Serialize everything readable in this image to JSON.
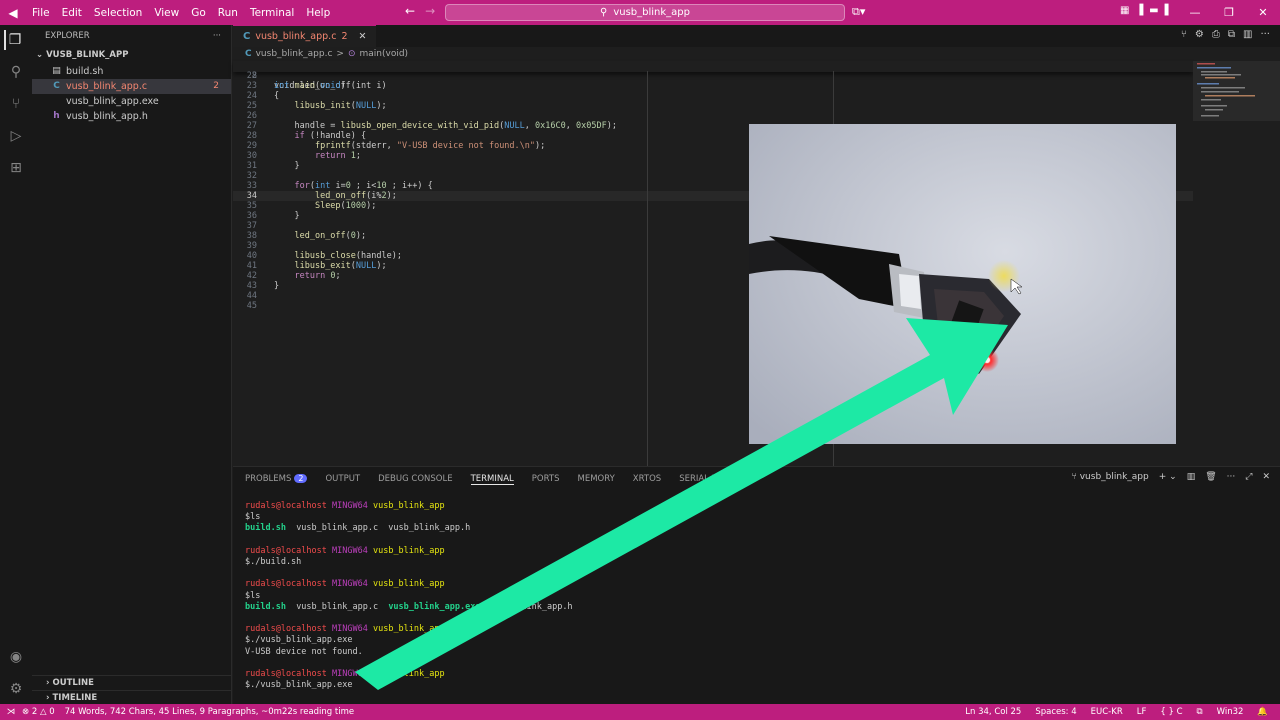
{
  "titlebar": {
    "logo": "◀",
    "menu": [
      "File",
      "Edit",
      "Selection",
      "View",
      "Go",
      "Run",
      "Terminal",
      "Help"
    ],
    "search_text": "vusb_blink_app"
  },
  "sidebar": {
    "header": "EXPLORER",
    "folder": "VUSB_BLINK_APP",
    "files": [
      {
        "name": "build.sh",
        "icon": "shell-icon"
      },
      {
        "name": "vusb_blink_app.c",
        "icon": "c-file-icon",
        "badge": "2"
      },
      {
        "name": "vusb_blink_app.exe",
        "icon": "file-icon"
      },
      {
        "name": "vusb_blink_app.h",
        "icon": "h-file-icon"
      }
    ],
    "outline": "OUTLINE",
    "timeline": "TIMELINE"
  },
  "editor": {
    "tab_label": "vusb_blink_app.c",
    "tab_badge": "2",
    "breadcrumb_file": "vusb_blink_app.c",
    "breadcrumb_sep": ">",
    "breadcrumb_symbol": "main(void)",
    "sticky_line_no": "8",
    "sticky_line": "void led_on_off(int i)",
    "lines": [
      {
        "n": "22",
        "t": ""
      },
      {
        "n": "23",
        "t": "int main(void)"
      },
      {
        "n": "24",
        "t": "{"
      },
      {
        "n": "25",
        "t": "    libusb_init(NULL);"
      },
      {
        "n": "26",
        "t": ""
      },
      {
        "n": "27",
        "t": "    handle = libusb_open_device_with_vid_pid(NULL, 0x16C0, 0x05DF);"
      },
      {
        "n": "28",
        "t": "    if (!handle) {"
      },
      {
        "n": "29",
        "t": "        fprintf(stderr, \"V-USB device not found.\\n\");"
      },
      {
        "n": "30",
        "t": "        return 1;"
      },
      {
        "n": "31",
        "t": "    }"
      },
      {
        "n": "32",
        "t": ""
      },
      {
        "n": "33",
        "t": "    for(int i=0 ; i<10 ; i++) {"
      },
      {
        "n": "34",
        "t": "        led_on_off(i%2);"
      },
      {
        "n": "35",
        "t": "        Sleep(1000);"
      },
      {
        "n": "36",
        "t": "    }"
      },
      {
        "n": "37",
        "t": ""
      },
      {
        "n": "38",
        "t": "    led_on_off(0);"
      },
      {
        "n": "39",
        "t": ""
      },
      {
        "n": "40",
        "t": "    libusb_close(handle);"
      },
      {
        "n": "41",
        "t": "    libusb_exit(NULL);"
      },
      {
        "n": "42",
        "t": "    return 0;"
      },
      {
        "n": "43",
        "t": "}"
      },
      {
        "n": "44",
        "t": ""
      },
      {
        "n": "45",
        "t": ""
      }
    ]
  },
  "panel": {
    "tabs": [
      "PROBLEMS",
      "OUTPUT",
      "DEBUG CONSOLE",
      "TERMINAL",
      "PORTS",
      "MEMORY",
      "XRTOS",
      "SERIAL MONITOR"
    ],
    "problems_badge": "2",
    "terminal_name": "vusb_blink_app",
    "prompt_user": "rudals@localhost",
    "prompt_env": "MINGW64",
    "prompt_dir": "vusb_blink_app",
    "cmd1": "$ls",
    "out1_build": "build.sh",
    "out1_rest": "  vusb_blink_app.c  vusb_blink_app.h",
    "cmd2": "$./build.sh",
    "cmd3": "$ls",
    "out3_build": "build.sh",
    "out3_c": "  vusb_blink_app.c  ",
    "out3_exe": "vusb_blink_app.exe",
    "out3_h": "  vusb_blink_app.h",
    "cmd4": "$./vusb_blink_app.exe",
    "out4": "V-USB device not found.",
    "cmd5": "$./vusb_blink_app.exe"
  },
  "statusbar": {
    "errors": "2",
    "warnings": "0",
    "word_count": "74 Words, 742 Chars, 45 Lines, 9 Paragraphs, ~0m22s reading time",
    "position": "Ln 34, Col 25",
    "spaces": "Spaces: 4",
    "encoding": "EUC-KR",
    "eol": "LF",
    "language": "C",
    "platform": "Win32"
  },
  "colors": {
    "accent": "#bd1e7e",
    "arrow": "#1de9a5",
    "led": "#ff2a2a"
  }
}
